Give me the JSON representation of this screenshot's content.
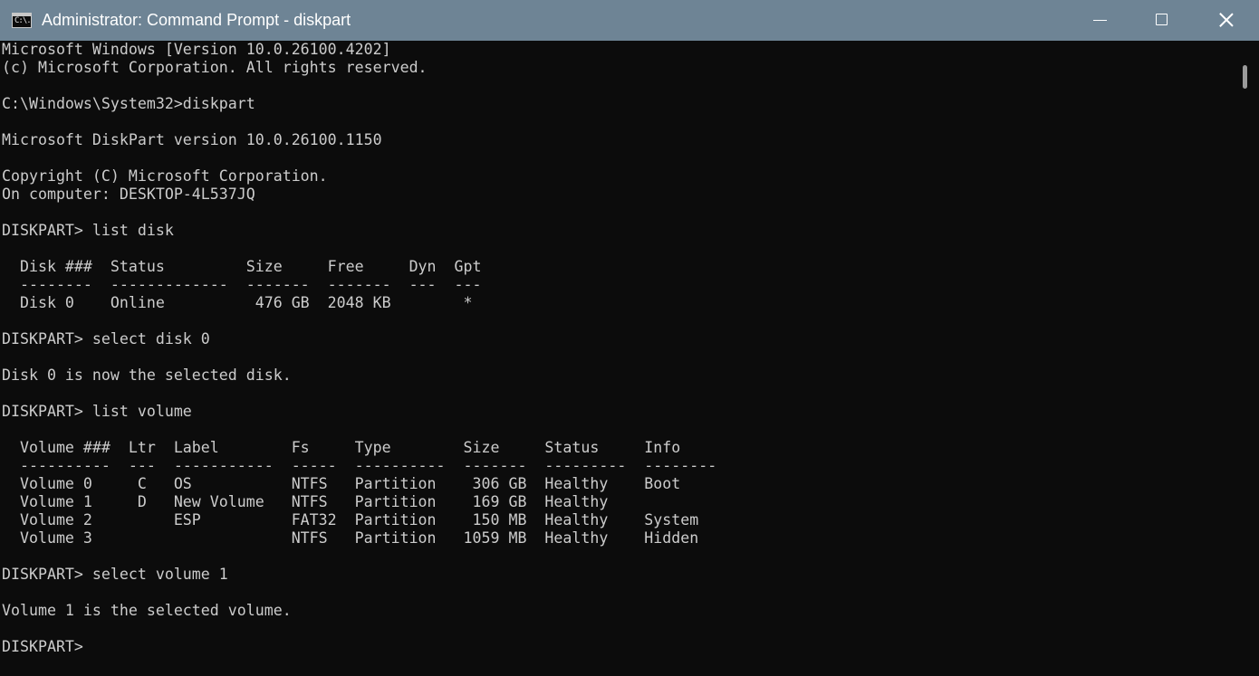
{
  "window": {
    "title": "Administrator: Command Prompt - diskpart",
    "app_icon": "cmd-prompt-icon",
    "app_icon_glyph": "C:\\.",
    "controls": {
      "minimize": "minimize-icon",
      "maximize": "maximize-icon",
      "close": "close-icon"
    },
    "titlebar_color": "#6e8495",
    "console_background": "#0c0c0c",
    "console_foreground": "#cccccc"
  },
  "console": {
    "lines": [
      "Microsoft Windows [Version 10.0.26100.4202]",
      "(c) Microsoft Corporation. All rights reserved.",
      "",
      "C:\\Windows\\System32>diskpart",
      "",
      "Microsoft DiskPart version 10.0.26100.1150",
      "",
      "Copyright (C) Microsoft Corporation.",
      "On computer: DESKTOP-4L537JQ",
      "",
      "DISKPART> list disk",
      "",
      "  Disk ###  Status         Size     Free     Dyn  Gpt",
      "  --------  -------------  -------  -------  ---  ---",
      "  Disk 0    Online          476 GB  2048 KB        *",
      "",
      "DISKPART> select disk 0",
      "",
      "Disk 0 is now the selected disk.",
      "",
      "DISKPART> list volume",
      "",
      "  Volume ###  Ltr  Label        Fs     Type        Size     Status     Info",
      "  ----------  ---  -----------  -----  ----------  -------  ---------  --------",
      "  Volume 0     C   OS           NTFS   Partition    306 GB  Healthy    Boot",
      "  Volume 1     D   New Volume   NTFS   Partition    169 GB  Healthy",
      "  Volume 2         ESP          FAT32  Partition    150 MB  Healthy    System",
      "  Volume 3                      NTFS   Partition   1059 MB  Healthy    Hidden",
      "",
      "DISKPART> select volume 1",
      "",
      "Volume 1 is the selected volume.",
      "",
      "DISKPART> "
    ]
  }
}
